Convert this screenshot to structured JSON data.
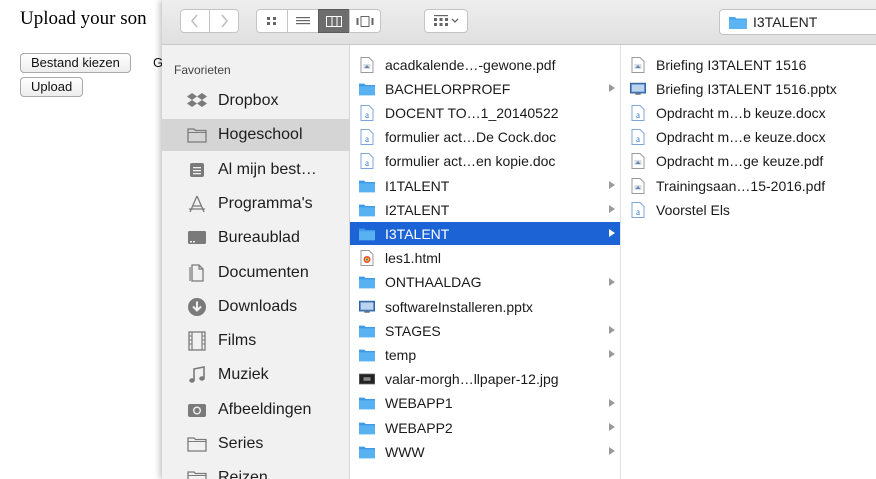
{
  "background_page": {
    "title": "Upload your son",
    "choose_file_label": "Bestand kiezen",
    "cut_text": "G",
    "upload_label": "Upload"
  },
  "toolbar": {
    "location": "I3TALENT",
    "view_modes": [
      "icon-view-icon",
      "list-view-icon",
      "column-view-icon",
      "cover-flow-icon"
    ],
    "active_view": "column"
  },
  "sidebar": {
    "header": "Favorieten",
    "items": [
      {
        "label": "Dropbox",
        "icon": "dropbox-icon"
      },
      {
        "label": "Hogeschool",
        "icon": "folder-icon",
        "selected": true
      },
      {
        "label": "Al mijn best…",
        "icon": "all-files-icon"
      },
      {
        "label": "Programma's",
        "icon": "applications-icon"
      },
      {
        "label": "Bureaublad",
        "icon": "desktop-icon"
      },
      {
        "label": "Documenten",
        "icon": "documents-icon"
      },
      {
        "label": "Downloads",
        "icon": "downloads-icon"
      },
      {
        "label": "Films",
        "icon": "movies-icon"
      },
      {
        "label": "Muziek",
        "icon": "music-icon"
      },
      {
        "label": "Afbeeldingen",
        "icon": "pictures-icon"
      },
      {
        "label": "Series",
        "icon": "folder-icon"
      },
      {
        "label": "Reizen",
        "icon": "folder-icon"
      }
    ]
  },
  "column1": {
    "items": [
      {
        "name": "acadkalende…-gewone.pdf",
        "type": "pdf"
      },
      {
        "name": "BACHELORPROEF",
        "type": "folder"
      },
      {
        "name": "DOCENT TO…1_20140522",
        "type": "doc"
      },
      {
        "name": "formulier act…De Cock.doc",
        "type": "doc"
      },
      {
        "name": "formulier act…en kopie.doc",
        "type": "doc"
      },
      {
        "name": "I1TALENT",
        "type": "folder"
      },
      {
        "name": "I2TALENT",
        "type": "folder"
      },
      {
        "name": "I3TALENT",
        "type": "folder",
        "selected": true
      },
      {
        "name": "les1.html",
        "type": "html"
      },
      {
        "name": "ONTHAALDAG",
        "type": "folder"
      },
      {
        "name": "softwareInstalleren.pptx",
        "type": "pptx"
      },
      {
        "name": "STAGES",
        "type": "folder"
      },
      {
        "name": "temp",
        "type": "folder"
      },
      {
        "name": "valar-morgh…llpaper-12.jpg",
        "type": "jpg"
      },
      {
        "name": "WEBAPP1",
        "type": "folder"
      },
      {
        "name": "WEBAPP2",
        "type": "folder"
      },
      {
        "name": "WWW",
        "type": "folder"
      }
    ]
  },
  "column2": {
    "items": [
      {
        "name": "Briefing I3TALENT 1516",
        "type": "pdf"
      },
      {
        "name": "Briefing I3TALENT 1516.pptx",
        "type": "pptx"
      },
      {
        "name": "Opdracht m…b keuze.docx",
        "type": "doc"
      },
      {
        "name": "Opdracht m…e keuze.docx",
        "type": "doc"
      },
      {
        "name": "Opdracht m…ge keuze.pdf",
        "type": "pdf"
      },
      {
        "name": "Trainingsaan…15-2016.pdf",
        "type": "pdf"
      },
      {
        "name": "Voorstel Els",
        "type": "doc"
      }
    ]
  },
  "colors": {
    "selection": "#1c63d6",
    "folder": "#4aa8ee",
    "sidebar_bg": "#f1f1f1"
  }
}
